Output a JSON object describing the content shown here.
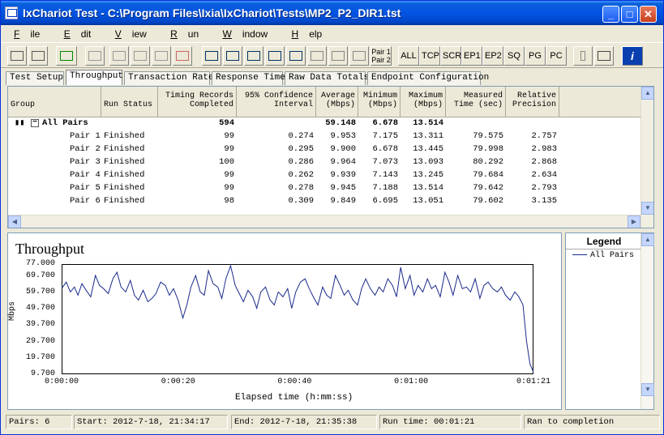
{
  "window": {
    "title": "IxChariot Test - C:\\Program Files\\Ixia\\IxChariot\\Tests\\MP2_P2_DIR1.tst",
    "minimize_label": "_",
    "maximize_label": "□",
    "close_label": "✕"
  },
  "menu": [
    {
      "label": "File",
      "accel": "F",
      "rest": "ile"
    },
    {
      "label": "Edit",
      "accel": "E",
      "rest": "dit"
    },
    {
      "label": "View",
      "accel": "V",
      "rest": "iew"
    },
    {
      "label": "Run",
      "accel": "R",
      "rest": "un"
    },
    {
      "label": "Window",
      "accel": "W",
      "rest": "indow"
    },
    {
      "label": "Help",
      "accel": "H",
      "rest": "elp"
    }
  ],
  "toolbar": {
    "pair_label_1": "Pair 1",
    "pair_label_2": "Pair 2",
    "text_buttons": [
      "ALL",
      "TCP",
      "SCR",
      "EP1",
      "EP2",
      "SQ",
      "PG",
      "PC"
    ],
    "help_label": "i"
  },
  "tabs": [
    "Test Setup",
    "Throughput",
    "Transaction Rate",
    "Response Time",
    "Raw Data Totals",
    "Endpoint Configuration"
  ],
  "active_tab": "Throughput",
  "table": {
    "headers": [
      {
        "l1": "",
        "l2": "Group"
      },
      {
        "l1": "",
        "l2": "Run Status"
      },
      {
        "l1": "Timing Records",
        "l2": "Completed"
      },
      {
        "l1": "95% Confidence",
        "l2": "Interval"
      },
      {
        "l1": "Average",
        "l2": "(Mbps)"
      },
      {
        "l1": "Minimum",
        "l2": "(Mbps)"
      },
      {
        "l1": "Maximum",
        "l2": "(Mbps)"
      },
      {
        "l1": "Measured",
        "l2": "Time (sec)"
      },
      {
        "l1": "Relative",
        "l2": "Precision"
      }
    ],
    "total": {
      "expander": "−",
      "group": "All Pairs",
      "records": "594",
      "average": "59.148",
      "minimum": "6.678",
      "maximum": "13.514"
    },
    "rows": [
      {
        "group": "Pair 1",
        "status": "Finished",
        "records": "99",
        "ci": "0.274",
        "average": "9.953",
        "minimum": "7.175",
        "maximum": "13.311",
        "time": "79.575",
        "precision": "2.757"
      },
      {
        "group": "Pair 2",
        "status": "Finished",
        "records": "99",
        "ci": "0.295",
        "average": "9.900",
        "minimum": "6.678",
        "maximum": "13.445",
        "time": "79.998",
        "precision": "2.983"
      },
      {
        "group": "Pair 3",
        "status": "Finished",
        "records": "100",
        "ci": "0.286",
        "average": "9.964",
        "minimum": "7.073",
        "maximum": "13.093",
        "time": "80.292",
        "precision": "2.868"
      },
      {
        "group": "Pair 4",
        "status": "Finished",
        "records": "99",
        "ci": "0.262",
        "average": "9.939",
        "minimum": "7.143",
        "maximum": "13.245",
        "time": "79.684",
        "precision": "2.634"
      },
      {
        "group": "Pair 5",
        "status": "Finished",
        "records": "99",
        "ci": "0.278",
        "average": "9.945",
        "minimum": "7.188",
        "maximum": "13.514",
        "time": "79.642",
        "precision": "2.793"
      },
      {
        "group": "Pair 6",
        "status": "Finished",
        "records": "98",
        "ci": "0.309",
        "average": "9.849",
        "minimum": "6.695",
        "maximum": "13.051",
        "time": "79.602",
        "precision": "3.135"
      }
    ]
  },
  "legend": {
    "title": "Legend",
    "items": [
      "All Pairs"
    ],
    "line_color": "#1a2a8a"
  },
  "status": {
    "pairs": "Pairs: 6",
    "start": "Start: 2012-7-18, 21:34:17",
    "end": "End: 2012-7-18, 21:35:38",
    "run_time": "Run time: 00:01:21",
    "state": "Ran to completion"
  },
  "chart_data": {
    "type": "line",
    "title": "Throughput",
    "xlabel": "Elapsed time (h:mm:ss)",
    "ylabel": "Mbps",
    "x_range_seconds": [
      0,
      81
    ],
    "xtick_labels": [
      "0:00:00",
      "0:00:20",
      "0:00:40",
      "0:01:00",
      "0:01:21"
    ],
    "xtick_seconds": [
      0,
      20,
      40,
      60,
      81
    ],
    "ytick_labels": [
      "77.000",
      "69.700",
      "59.700",
      "49.700",
      "39.700",
      "29.700",
      "19.700",
      "9.700"
    ],
    "ylim": [
      9.7,
      77.0
    ],
    "series": [
      {
        "name": "All Pairs",
        "x": [
          0,
          0.8,
          1.5,
          2.2,
          2.8,
          3.5,
          4.2,
          5,
          5.8,
          6.5,
          7.2,
          8,
          8.8,
          9.5,
          10.2,
          11,
          11.8,
          12.5,
          13.2,
          14,
          14.8,
          15.5,
          16.2,
          17,
          17.8,
          18.5,
          19.2,
          20,
          20.8,
          21.5,
          22.2,
          23,
          23.8,
          24.5,
          25.2,
          26,
          26.8,
          27.5,
          28.2,
          29,
          29.8,
          30.5,
          31.2,
          32,
          32.8,
          33.5,
          34.2,
          35,
          35.8,
          36.5,
          37.2,
          38,
          38.8,
          39.5,
          40.2,
          41,
          41.8,
          42.5,
          43.2,
          44,
          44.8,
          45.5,
          46.2,
          47,
          47.8,
          48.5,
          49.2,
          50,
          50.8,
          51.5,
          52.2,
          53,
          53.8,
          54.5,
          55.2,
          56,
          56.8,
          57.5,
          58.2,
          59,
          59.8,
          60.5,
          61.2,
          62,
          62.8,
          63.5,
          64.2,
          65,
          65.8,
          66.5,
          67.2,
          68,
          68.8,
          69.5,
          70.2,
          71,
          71.8,
          72.5,
          73.2,
          74,
          74.8,
          75.5,
          76.2,
          77,
          77.8,
          78.5,
          79.2,
          79.8,
          80.4,
          81
        ],
        "y": [
          62,
          66,
          60,
          63,
          58,
          65,
          61,
          57,
          70,
          64,
          62,
          59,
          68,
          72,
          63,
          60,
          67,
          58,
          55,
          61,
          54,
          56,
          59,
          66,
          64,
          58,
          62,
          55,
          44,
          52,
          63,
          70,
          60,
          58,
          73,
          65,
          63,
          56,
          68,
          76,
          64,
          59,
          54,
          61,
          57,
          50,
          60,
          63,
          55,
          52,
          60,
          57,
          62,
          50,
          60,
          66,
          68,
          62,
          57,
          52,
          63,
          58,
          56,
          70,
          64,
          58,
          61,
          55,
          52,
          62,
          68,
          62,
          58,
          63,
          60,
          68,
          64,
          57,
          75,
          62,
          70,
          58,
          64,
          60,
          68,
          62,
          64,
          57,
          72,
          66,
          58,
          70,
          62,
          63,
          60,
          68,
          56,
          64,
          66,
          62,
          60,
          63,
          58,
          55,
          60,
          57,
          52,
          30,
          16,
          11
        ]
      }
    ],
    "grid": false,
    "legend": "right-panel"
  }
}
